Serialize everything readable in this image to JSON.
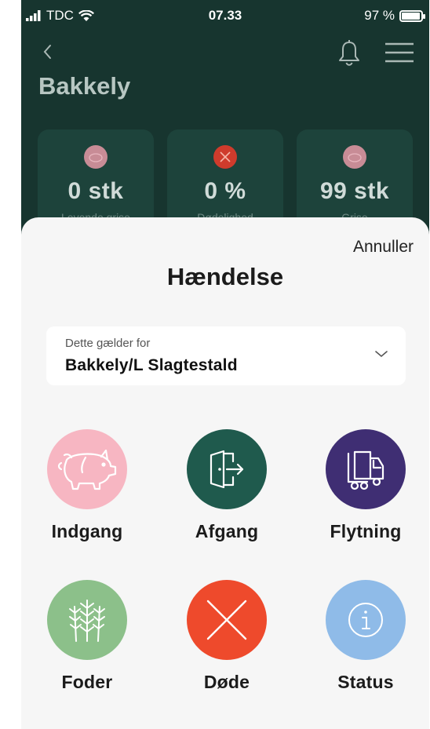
{
  "statusbar": {
    "carrier": "TDC",
    "time": "07.33",
    "battery_text": "97 %",
    "battery_level": 0.97
  },
  "header": {
    "title": "Bakkely"
  },
  "stats": [
    {
      "value": "0 stk",
      "label": "Levende grise",
      "icon": "pig-icon",
      "icon_color": "#c88c96"
    },
    {
      "value": "0 %",
      "label": "Dødelighed",
      "icon": "x-icon",
      "icon_color": "#cf3b2c"
    },
    {
      "value": "99 stk",
      "label": "Grise",
      "icon": "pig-icon",
      "icon_color": "#c88c96"
    }
  ],
  "sheet": {
    "cancel_label": "Annuller",
    "title": "Hændelse",
    "selector": {
      "label": "Dette gælder for",
      "value": "Bakkely/L Slagtestald"
    },
    "actions": [
      {
        "label": "Indgang",
        "icon": "pig-icon",
        "color": "#f7b6c2"
      },
      {
        "label": "Afgang",
        "icon": "door-exit-icon",
        "color": "#1f5a4d"
      },
      {
        "label": "Flytning",
        "icon": "truck-icon",
        "color": "#3f2e73"
      },
      {
        "label": "Foder",
        "icon": "wheat-icon",
        "color": "#8cc08a"
      },
      {
        "label": "Døde",
        "icon": "close-icon",
        "color": "#ee4a2c"
      },
      {
        "label": "Status",
        "icon": "info-icon",
        "color": "#8fbbe8"
      }
    ]
  }
}
